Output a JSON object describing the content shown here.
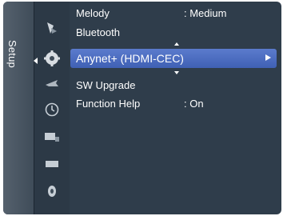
{
  "tab": {
    "label": "Setup"
  },
  "sidebar_icons": [
    {
      "name": "picture-icon"
    },
    {
      "name": "setup-gear-icon"
    },
    {
      "name": "channel-antenna-icon"
    },
    {
      "name": "clock-icon"
    },
    {
      "name": "input-icon"
    },
    {
      "name": "display-icon"
    },
    {
      "name": "sound-icon"
    }
  ],
  "menu": {
    "items": [
      {
        "label": "Melody",
        "value": ": Medium"
      },
      {
        "label": "Bluetooth",
        "value": ""
      },
      {
        "label": "Anynet+ (HDMI-CEC)",
        "value": "",
        "selected": true
      },
      {
        "label": "SW Upgrade",
        "value": ""
      },
      {
        "label": "Function Help",
        "value": ": On"
      }
    ]
  },
  "colors": {
    "background": "#2f3d4b",
    "highlight": "#4f6fc4",
    "text": "#ffffff"
  }
}
